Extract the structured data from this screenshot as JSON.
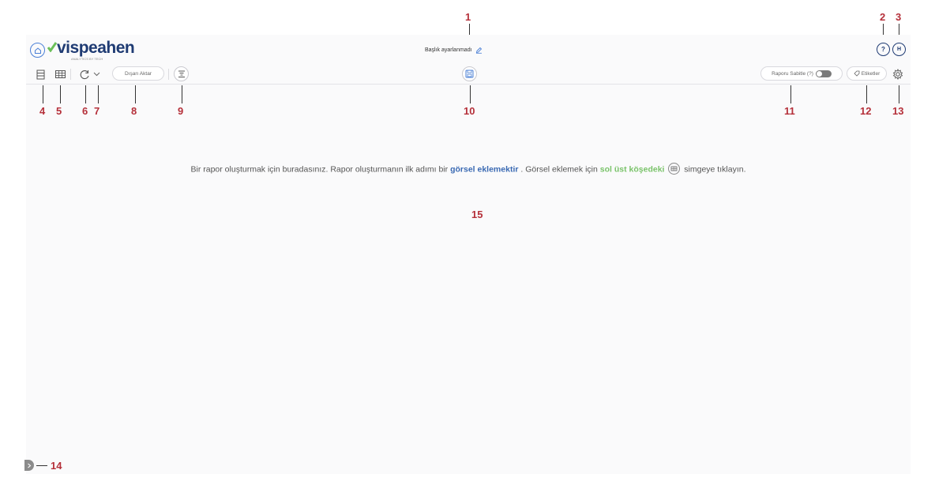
{
  "header": {
    "logo_text": "vispeahen",
    "logo_tagline": "ANALYTICS BY TECH",
    "report_title": "Başlık ayarlanmadı",
    "help_label": "?",
    "avatar_initial": "H"
  },
  "toolbar": {
    "export_label": "Dışarı Aktar",
    "pin_report_label": "Raporu Sabitle (?)",
    "tags_label": "Etiketler"
  },
  "main": {
    "message_part1": "Bir rapor oluşturmak için buradasınız. Rapor oluşturmanın ilk adımı bir ",
    "message_highlight1": "görsel eklemektir",
    "message_part2": " . Görsel eklemek için ",
    "message_highlight2": "sol üst köşedeki",
    "message_part3": " simgeye tıklayın."
  },
  "annotations": {
    "a1": "1",
    "a2": "2",
    "a3": "3",
    "a4": "4",
    "a5": "5",
    "a6": "6",
    "a7": "7",
    "a8": "8",
    "a9": "9",
    "a10": "10",
    "a11": "11",
    "a12": "12",
    "a13": "13",
    "a14": "14",
    "a15": "15"
  },
  "colors": {
    "brand_blue": "#1f3b73",
    "link_blue": "#3b6ab3",
    "accent_green": "#7ac36a",
    "annotation_red": "#b5303a"
  },
  "icons": [
    "home-icon",
    "edit-pencil-icon",
    "list-view-icon",
    "table-view-icon",
    "refresh-icon",
    "chevron-down-icon",
    "filter-icon",
    "save-icon",
    "tag-icon",
    "gear-icon",
    "chevron-right-icon"
  ]
}
